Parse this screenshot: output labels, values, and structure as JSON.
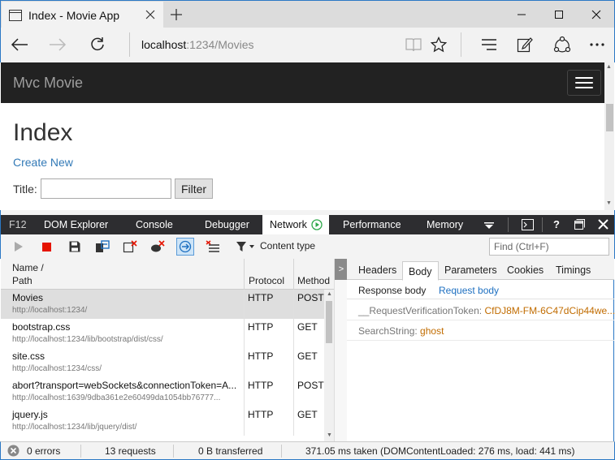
{
  "browser": {
    "tab_title": "Index - Movie App",
    "url_host": "localhost",
    "url_rest": ":1234/Movies"
  },
  "page": {
    "brand": "Mvc Movie",
    "heading": "Index",
    "create_link": "Create New",
    "title_label": "Title:",
    "title_value": "",
    "filter_button": "Filter"
  },
  "devtools": {
    "tabs": [
      "F12",
      "DOM Explorer",
      "Console",
      "Debugger",
      "Network",
      "Performance",
      "Memory"
    ],
    "active_tab": "Network",
    "content_type_label": "Content type",
    "find_placeholder": "Find (Ctrl+F)",
    "columns": {
      "name": "Name /",
      "path": "Path",
      "protocol": "Protocol",
      "method": "Method"
    },
    "requests": [
      {
        "name": "Movies",
        "path": "http://localhost:1234/",
        "protocol": "HTTP",
        "method": "POST"
      },
      {
        "name": "bootstrap.css",
        "path": "http://localhost:1234/lib/bootstrap/dist/css/",
        "protocol": "HTTP",
        "method": "GET"
      },
      {
        "name": "site.css",
        "path": "http://localhost:1234/css/",
        "protocol": "HTTP",
        "method": "GET"
      },
      {
        "name": "abort?transport=webSockets&connectionToken=A...",
        "path": "http://localhost:1639/9dba361e2e60499da1054bb76777...",
        "protocol": "HTTP",
        "method": "POST"
      },
      {
        "name": "jquery.js",
        "path": "http://localhost:1234/lib/jquery/dist/",
        "protocol": "HTTP",
        "method": "GET"
      }
    ],
    "detail_tabs": [
      "Headers",
      "Body",
      "Parameters",
      "Cookies",
      "Timings"
    ],
    "active_detail_tab": "Body",
    "sub_tabs": {
      "response": "Response body",
      "request": "Request body"
    },
    "body_fields": [
      {
        "key": "__RequestVerificationToken:",
        "value": "CfDJ8M-FM-6C47dCip44we..."
      },
      {
        "key": "SearchString:",
        "value": "ghost"
      }
    ],
    "status": {
      "errors": "0 errors",
      "requests": "13 requests",
      "transferred": "0 B transferred",
      "timing": "371.05 ms taken (DOMContentLoaded: 276 ms, load: 441 ms)"
    }
  },
  "colors": {
    "accent": "#2b78c5",
    "link": "#337ab7",
    "navbar": "#222222",
    "token_value": "#c16c00"
  }
}
